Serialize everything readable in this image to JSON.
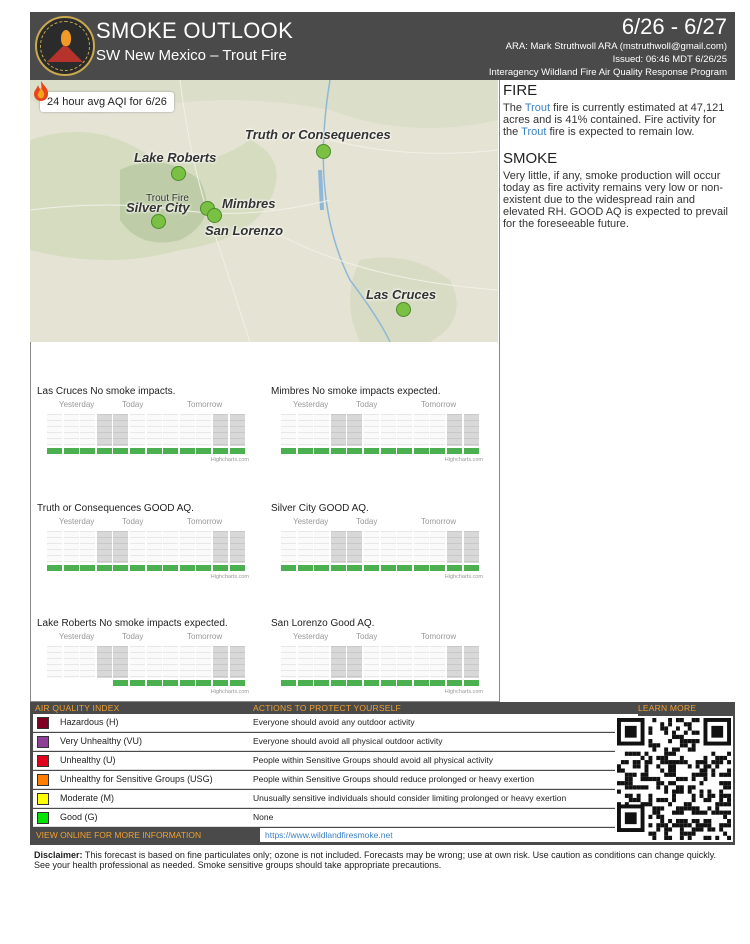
{
  "header": {
    "title": "SMOKE OUTLOOK",
    "subtitle": "SW New Mexico – Trout Fire",
    "dates": "6/26 - 6/27",
    "ara": "ARA: Mark Struthwoll ARA (mstruthwoll@gmail.com)",
    "issued": "Issued: 06:46 MDT 6/26/25",
    "program": "Interagency Wildland Fire Air Quality Response Program"
  },
  "map": {
    "caption": "24 hour avg AQI for 6/26",
    "fire_label": "Trout Fire",
    "cities": {
      "truth_or_consequences": "Truth or Consequences",
      "lake_roberts": "Lake Roberts",
      "silver_city": "Silver City",
      "mimbres": "Mimbres",
      "san_lorenzo": "San Lorenzo",
      "las_cruces": "Las Cruces"
    },
    "dot_status": "Good",
    "dot_color": "#7ac143"
  },
  "fire": {
    "title": "FIRE",
    "text_1": "The ",
    "fire_name": "Trout",
    "text_2": " fire is currently estimated at 47,121 acres and is 41% contained. Fire activity for the ",
    "text_3": " fire is expected to remain low."
  },
  "smoke": {
    "title": "SMOKE",
    "text": "Very little, if any, smoke production will occur today as fire activity remains very low or non-existent due to the widespread rain and elevated RH. GOOD AQ is expected to prevail for the foreseeable future."
  },
  "forecast_days": {
    "yesterday": "Yesterday",
    "today": "Today",
    "tomorrow": "Tomorrow"
  },
  "forecast_credit": "Highcharts.com",
  "forecasts": [
    {
      "location": "Las Cruces",
      "status": "No smoke impacts.",
      "levels": [
        "Good",
        "Good",
        "Good",
        "Good",
        "Good",
        "Good",
        "Good",
        "Good",
        "Good",
        "Good",
        "Good",
        "Good"
      ]
    },
    {
      "location": "Mimbres",
      "status": "No smoke impacts expected.",
      "levels": [
        "Good",
        "Good",
        "Good",
        "Good",
        "Good",
        "Good",
        "Good",
        "Good",
        "Good",
        "Good",
        "Good",
        "Good"
      ]
    },
    {
      "location": "Truth or Consequences",
      "status": "GOOD AQ.",
      "levels": [
        "Good",
        "Good",
        "Good",
        "Good",
        "Good",
        "Good",
        "Good",
        "Good",
        "Good",
        "Good",
        "Good",
        "Good"
      ]
    },
    {
      "location": "Silver City",
      "status": "GOOD AQ.",
      "levels": [
        "Good",
        "Good",
        "Good",
        "Good",
        "Good",
        "Good",
        "Good",
        "Good",
        "Good",
        "Good",
        "Good",
        "Good"
      ]
    },
    {
      "location": "Lake Roberts",
      "status": "No smoke impacts expected.",
      "levels": [
        "None",
        "None",
        "None",
        "None",
        "Good",
        "Good",
        "Good",
        "Good",
        "Good",
        "Good",
        "Good",
        "Good"
      ]
    },
    {
      "location": "San Lorenzo",
      "status": "Good AQ.",
      "levels": [
        "Good",
        "Good",
        "Good",
        "Good",
        "Good",
        "Good",
        "Good",
        "Good",
        "Good",
        "Good",
        "Good",
        "Good"
      ]
    }
  ],
  "aqi_table": {
    "header_index": "AIR QUALITY INDEX",
    "header_actions": "ACTIONS TO PROTECT YOURSELF",
    "header_learn": "LEARN MORE",
    "rows": [
      {
        "name": "Hazardous (H)",
        "color": "#7e0023",
        "action": "Everyone should avoid any outdoor activity"
      },
      {
        "name": "Very Unhealthy (VU)",
        "color": "#8f3f97",
        "action": "Everyone should avoid all physical outdoor activity"
      },
      {
        "name": "Unhealthy (U)",
        "color": "#e3001b",
        "action": "People within Sensitive Groups should avoid all physical activity"
      },
      {
        "name": "Unhealthy for Sensitive Groups (USG)",
        "color": "#ff7e00",
        "action": "People within Sensitive Groups should reduce prolonged or heavy exertion"
      },
      {
        "name": "Moderate (M)",
        "color": "#ffff00",
        "action": "Unusually sensitive individuals should consider limiting prolonged or heavy exertion"
      },
      {
        "name": "Good (G)",
        "color": "#00e400",
        "action": "None"
      }
    ],
    "view_online": "VIEW ONLINE FOR MORE INFORMATION",
    "url": "https://www.wildlandfiresmoke.net"
  },
  "disclaimer": {
    "label": "Disclaimer:",
    "text": " This forecast is based on fine particulates only; ozone is not included. Forecasts may be wrong; use at own risk. Use caution as conditions can change quickly. See your health professional as needed. Smoke sensitive groups should take appropriate precautions."
  }
}
